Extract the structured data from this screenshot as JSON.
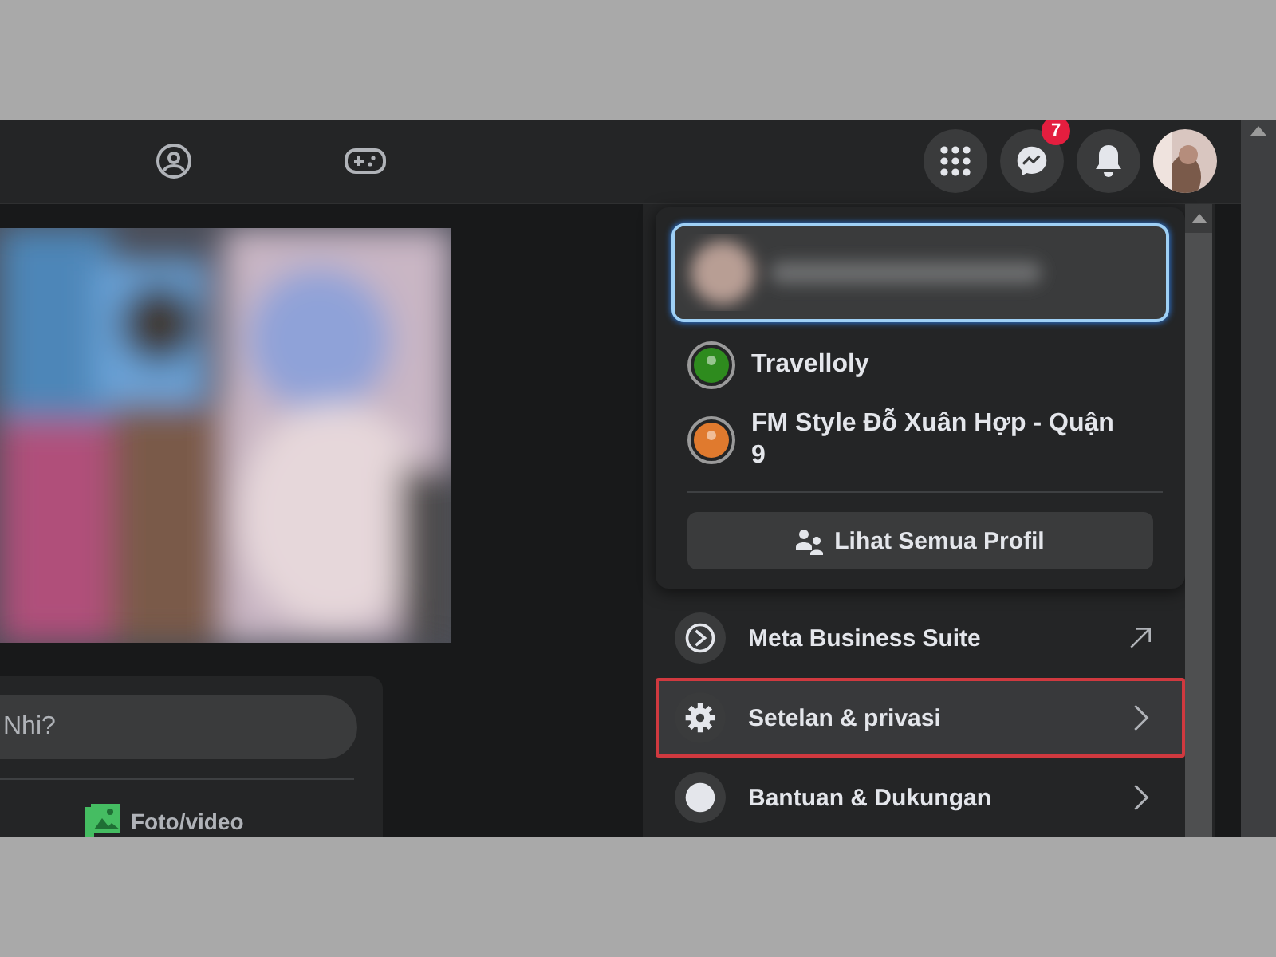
{
  "header": {
    "messenger_badge": "7"
  },
  "profile_menu": {
    "profiles": [
      {
        "name": "Travelloly",
        "color": "#2e8b1e"
      },
      {
        "name": "FM Style Đỗ Xuân Hợp - Quận 9",
        "color": "#e07a2e"
      }
    ],
    "see_all_button": "Lihat Semua Profil",
    "items": [
      {
        "label": "Meta Business Suite",
        "kind": "external",
        "selected": false
      },
      {
        "label": "Setelan & privasi",
        "kind": "submenu",
        "selected": true
      },
      {
        "label": "Bantuan & Dukungan",
        "kind": "submenu",
        "selected": false
      }
    ]
  },
  "composer": {
    "placeholder": "Nhi?",
    "actions": [
      {
        "label": "Foto/video"
      }
    ]
  }
}
